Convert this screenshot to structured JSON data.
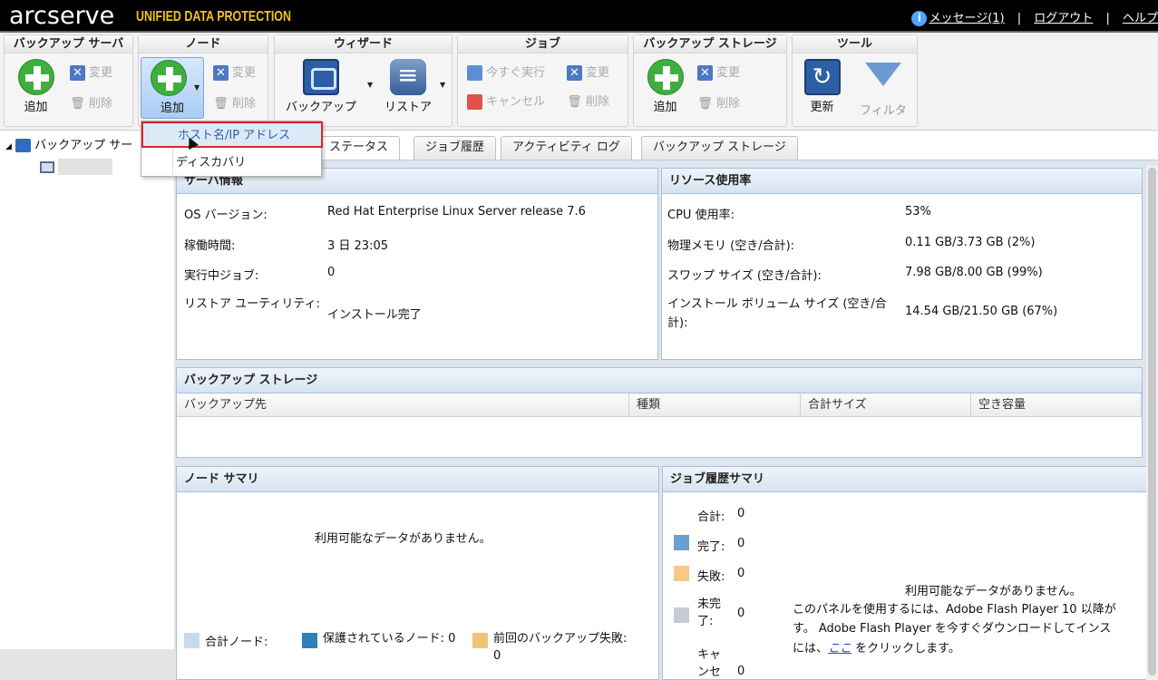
{
  "header": {
    "logo": "arcserve",
    "logo_sub": "UNIFIED DATA PROTECTION",
    "messages": "メッセージ(1)",
    "sep": "|",
    "logout": "ログアウト",
    "help": "ヘルプ"
  },
  "ribbon": {
    "backup_server": {
      "title": "バックアップ サーバ",
      "add": "追加",
      "edit": "変更",
      "delete": "削除"
    },
    "node": {
      "title": "ノード",
      "add": "追加",
      "edit": "変更",
      "delete": "削除"
    },
    "wizard": {
      "title": "ウィザード",
      "backup": "バックアップ",
      "restore": "リストア"
    },
    "job": {
      "title": "ジョブ",
      "run_now": "今すぐ実行",
      "edit": "変更",
      "cancel": "キャンセル",
      "delete": "削除"
    },
    "storage": {
      "title": "バックアップ ストレージ",
      "add": "追加",
      "edit": "変更",
      "delete": "削除"
    },
    "tools": {
      "title": "ツール",
      "refresh": "更新",
      "filter": "フィルタ"
    }
  },
  "dropdown": {
    "items": [
      "ホスト名/IP アドレス",
      "ディスカバリ"
    ]
  },
  "tree": {
    "root": "バックアップ サー"
  },
  "tabs": [
    "ステータス",
    "ジョブ履歴",
    "アクティビティ ログ",
    "バックアップ ストレージ"
  ],
  "server_info": {
    "title": "サーバ情報",
    "rows": [
      {
        "label": "OS バージョン:",
        "value": "Red Hat Enterprise Linux Server release 7.6"
      },
      {
        "label": "稼働時間:",
        "value": "3 日 23:05"
      },
      {
        "label": "実行中ジョブ:",
        "value": "0"
      },
      {
        "label": "リストア ユーティリティ:",
        "value": "インストール完了"
      }
    ]
  },
  "resource": {
    "title": "リソース使用率",
    "rows": [
      {
        "label": "CPU 使用率:",
        "value": "53%"
      },
      {
        "label": "物理メモリ (空き/合計):",
        "value": "0.11 GB/3.73 GB (2%)"
      },
      {
        "label": "スワップ サイズ (空き/合計):",
        "value": "7.98 GB/8.00 GB (99%)"
      },
      {
        "label": "インストール ボリューム サイズ (空き/合計):",
        "value": "14.54 GB/21.50 GB (67%)"
      }
    ]
  },
  "storage_panel": {
    "title": "バックアップ ストレージ",
    "columns": [
      "バックアップ先",
      "種類",
      "合計サイズ",
      "空き容量"
    ]
  },
  "node_summary": {
    "title": "ノード サマリ",
    "no_data": "利用可能なデータがありません。",
    "legend": [
      {
        "label": "合計ノード:",
        "color": "#c9d9ea"
      },
      {
        "label": "保護されているノード: 0",
        "color": "#2f7fb8"
      },
      {
        "label": "前回のバックアップ失敗: 0",
        "color": "#f3c27a"
      }
    ]
  },
  "job_summary": {
    "title": "ジョブ履歴サマリ",
    "rows": [
      {
        "label": "合計:",
        "value": "0",
        "color": ""
      },
      {
        "label": "完了:",
        "value": "0",
        "color": "#6b9fd0"
      },
      {
        "label": "失敗:",
        "value": "0",
        "color": "#f6c98a"
      },
      {
        "label": "未完了:",
        "value": "0",
        "color": "#c5ccd3"
      },
      {
        "label": "キャンセ",
        "value": "0",
        "color": ""
      }
    ],
    "no_data": "利用可能なデータがありません。",
    "flash_line1": "このパネルを使用するには、Adobe Flash Player 10 以降が",
    "flash_line2": "す。 Adobe Flash Player を今すぐダウンロードしてインス",
    "flash_line3_pre": "には、",
    "flash_link": "ここ",
    "flash_line3_post": " をクリックします。"
  }
}
